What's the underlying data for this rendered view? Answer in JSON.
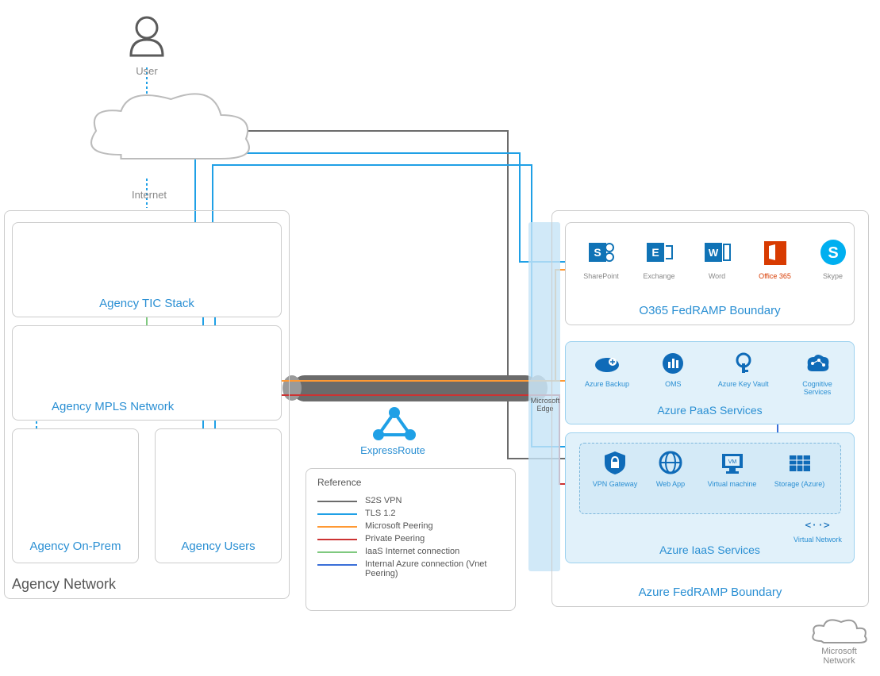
{
  "user": "User",
  "internet": "Internet",
  "agency_network": "Agency Network",
  "tic": "Agency TIC Stack",
  "mpls": "Agency MPLS Network",
  "onprem": "Agency On-Prem",
  "users": "Agency Users",
  "er": "ExpressRoute",
  "ms_edge": "Microsoft Edge",
  "o365": {
    "boundary": "O365 FedRAMP Boundary",
    "items": [
      {
        "label": "SharePoint"
      },
      {
        "label": "Exchange"
      },
      {
        "label": "Word"
      },
      {
        "label": "Office 365"
      },
      {
        "label": "Skype"
      }
    ]
  },
  "azure_boundary": "Azure FedRAMP Boundary",
  "paas": {
    "title": "Azure PaaS Services",
    "items": [
      {
        "label": "Azure Backup"
      },
      {
        "label": "OMS"
      },
      {
        "label": "Azure Key Vault"
      },
      {
        "label": "Cognitive Services"
      }
    ]
  },
  "iaas": {
    "title": "Azure IaaS Services",
    "items": [
      {
        "label": "VPN Gateway"
      },
      {
        "label": "Web App"
      },
      {
        "label": "Virtual machine"
      },
      {
        "label": "Storage (Azure)"
      }
    ],
    "vnet": "Virtual Network"
  },
  "ms_network": "Microsoft Network",
  "legend": {
    "title": "Reference",
    "items": [
      {
        "color": "#6b6b6b",
        "label": "S2S VPN"
      },
      {
        "color": "#1fa0e6",
        "label": "TLS 1.2"
      },
      {
        "color": "#ff9933",
        "label": "Microsoft Peering"
      },
      {
        "color": "#cc3333",
        "label": "Private Peering"
      },
      {
        "color": "#7fc97f",
        "label": "IaaS Internet connection"
      },
      {
        "color": "#3a6fd8",
        "label": "Internal Azure connection (Vnet Peering)"
      }
    ]
  }
}
